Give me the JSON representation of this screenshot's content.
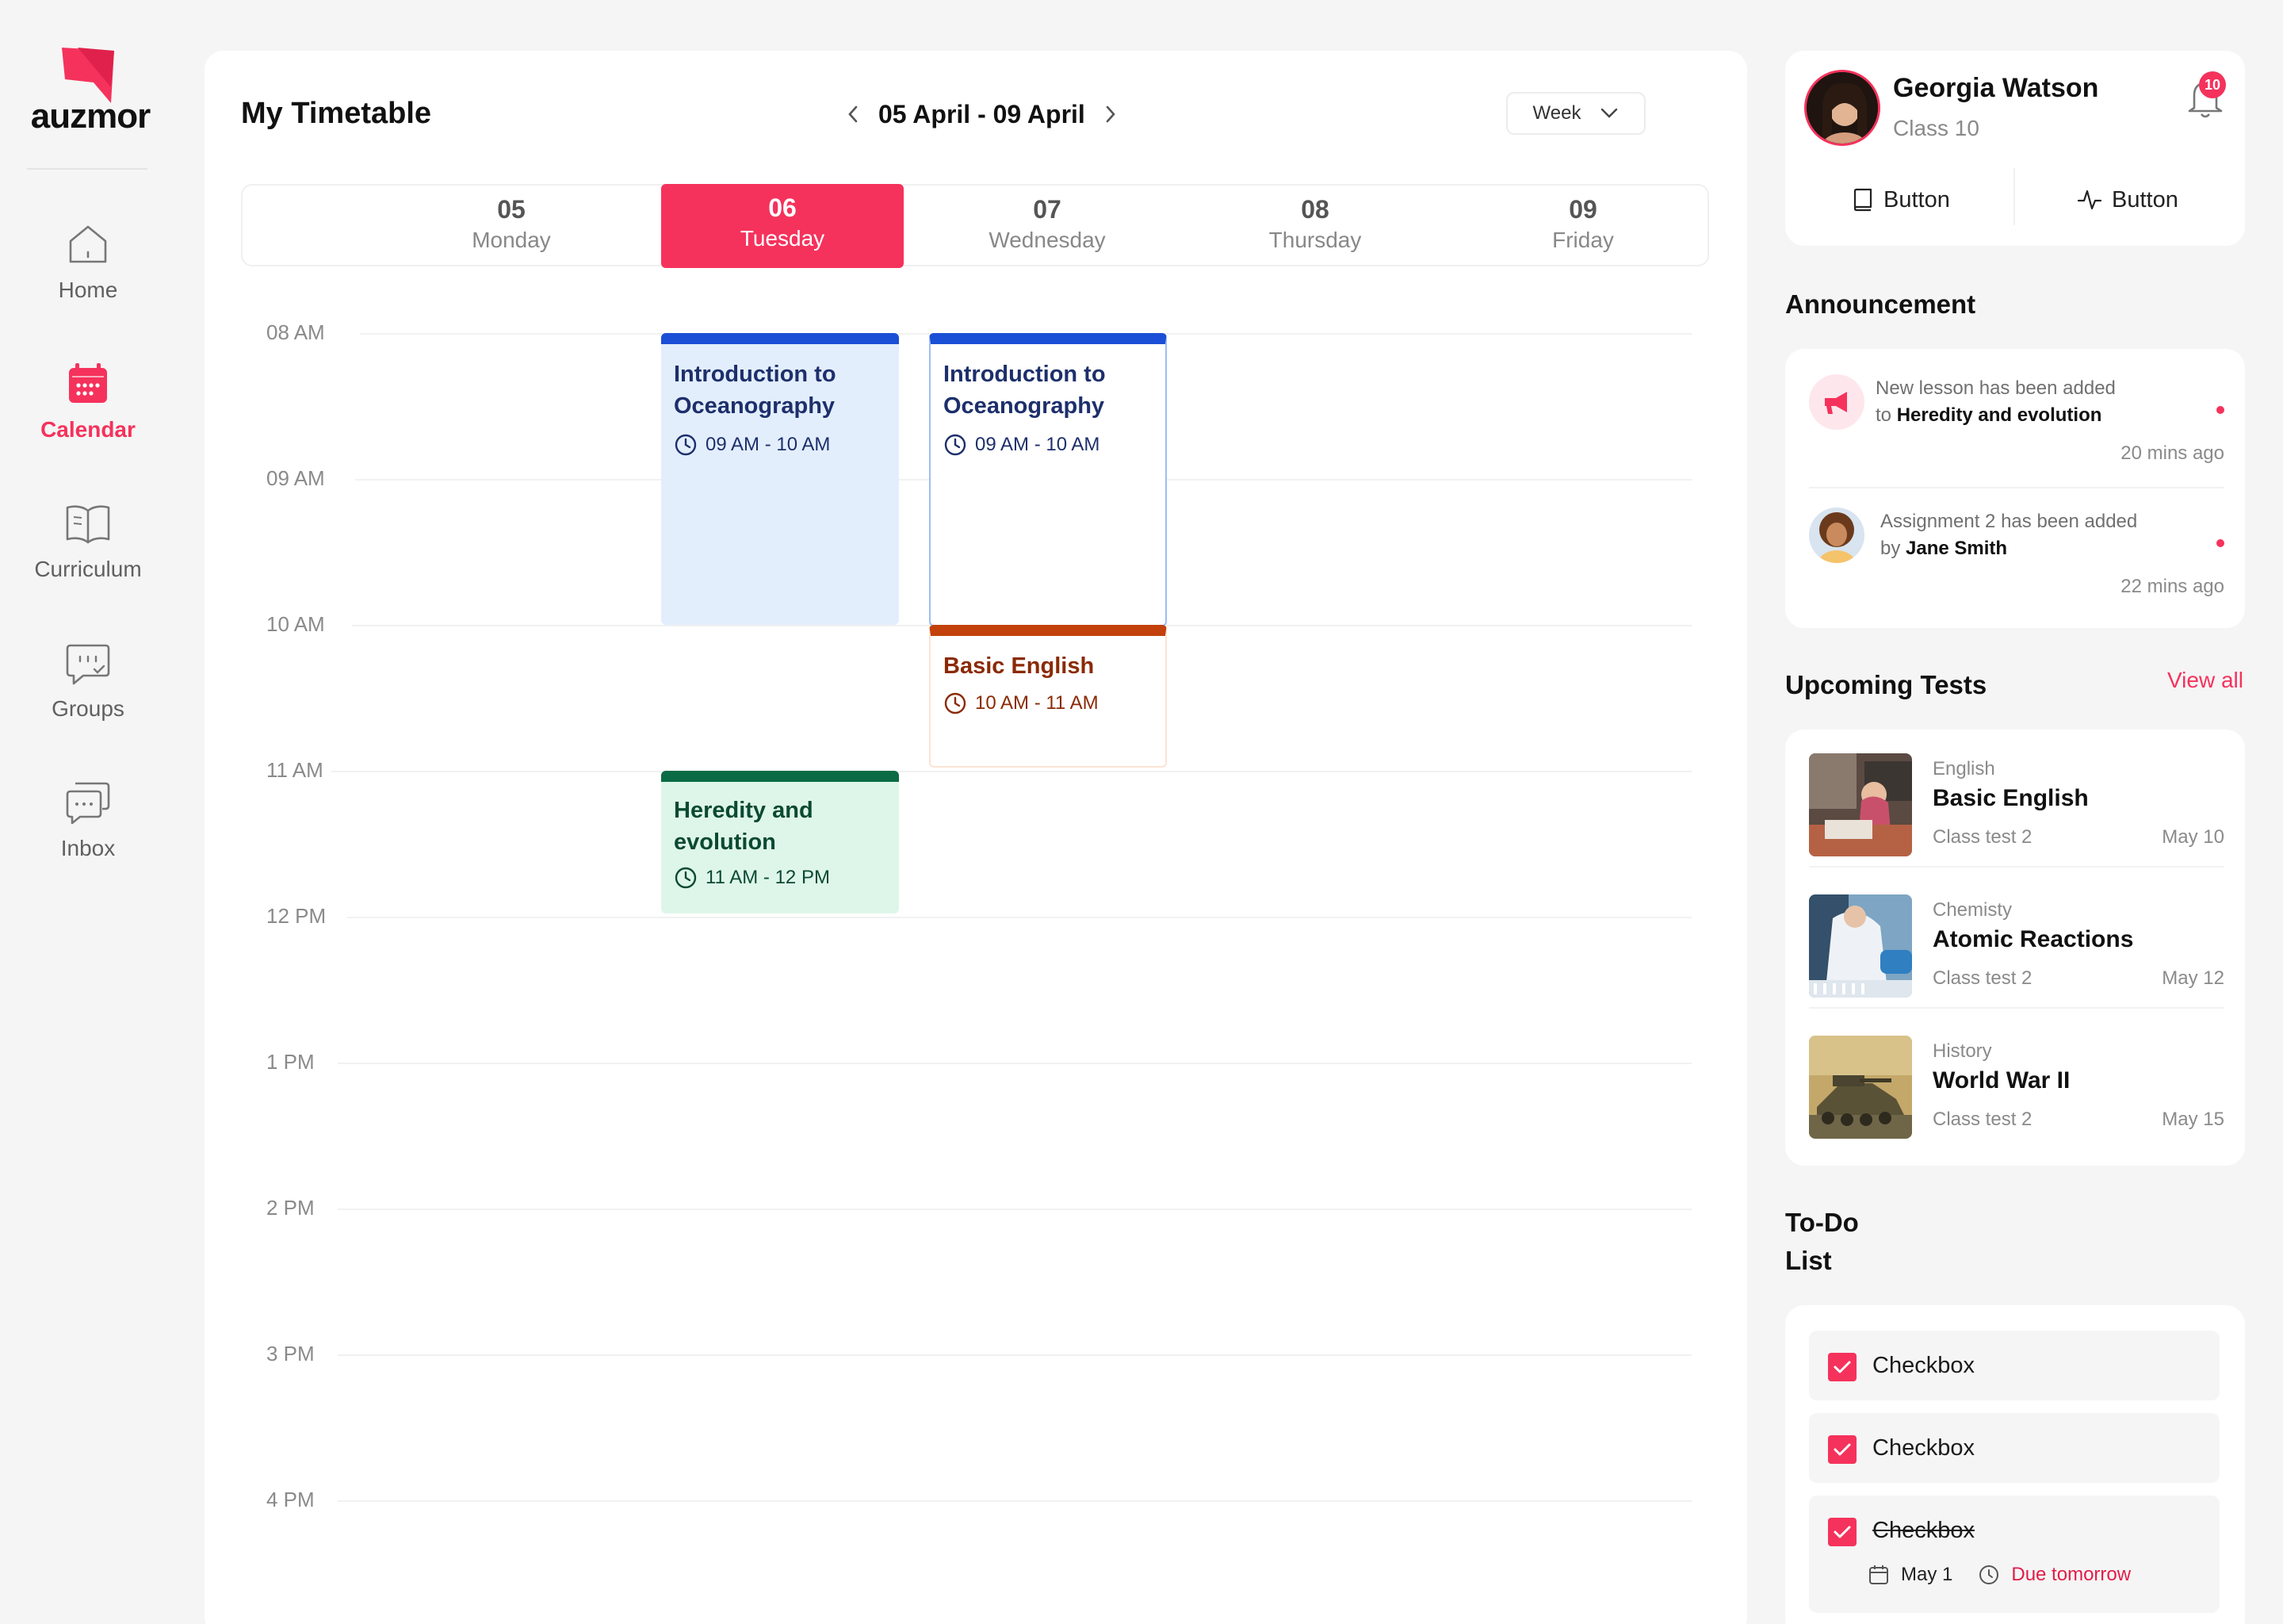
{
  "brand": {
    "name": "auzmor"
  },
  "nav": [
    {
      "label": "Home",
      "icon": "home-icon",
      "active": false
    },
    {
      "label": "Calendar",
      "icon": "calendar-icon",
      "active": true
    },
    {
      "label": "Curriculum",
      "icon": "book-icon",
      "active": false
    },
    {
      "label": "Groups",
      "icon": "groups-icon",
      "active": false
    },
    {
      "label": "Inbox",
      "icon": "inbox-icon",
      "active": false
    }
  ],
  "timetable": {
    "title": "My Timetable",
    "date_range": "05 April - 09 April",
    "view": "Week",
    "days": [
      {
        "num": "05",
        "name": "Monday",
        "active": false
      },
      {
        "num": "06",
        "name": "Tuesday",
        "active": true
      },
      {
        "num": "07",
        "name": "Wednesday",
        "active": false
      },
      {
        "num": "08",
        "name": "Thursday",
        "active": false
      },
      {
        "num": "09",
        "name": "Friday",
        "active": false
      }
    ],
    "times": [
      "08 AM",
      "09 AM",
      "10 AM",
      "11 AM",
      "12 PM",
      "1 PM",
      "2 PM",
      "3 PM",
      "4 PM"
    ],
    "events": [
      {
        "title": "Introduction to Oceanography",
        "time": "09 AM - 10 AM",
        "day": "Tuesday",
        "color": "#1b4fd6"
      },
      {
        "title": "Introduction to Oceanography",
        "time": "09 AM - 10 AM",
        "day": "Wednesday",
        "color": "#1b4fd6"
      },
      {
        "title": "Basic English",
        "time": "10 AM - 11 AM",
        "day": "Wednesday",
        "color": "#c2410c"
      },
      {
        "title": "Heredity and evolution",
        "time": "11 AM - 12 PM",
        "day": "Tuesday",
        "color": "#0b6b45"
      }
    ]
  },
  "profile": {
    "name": "Georgia Watson",
    "class": "Class 10",
    "notifications": "10",
    "button1": "Button",
    "button2": "Button"
  },
  "announcements": {
    "title": "Announcement",
    "items": [
      {
        "line1": "New lesson has been added",
        "prefix": "to",
        "bold": "Heredity and evolution",
        "time": "20 mins ago"
      },
      {
        "line1": "Assignment 2 has been added",
        "prefix": "by",
        "bold": "Jane Smith",
        "time": "22 mins ago"
      }
    ]
  },
  "tests": {
    "title": "Upcoming Tests",
    "view_all": "View all",
    "items": [
      {
        "subject": "English",
        "title": "Basic English",
        "meta": "Class test 2",
        "date": "May 10"
      },
      {
        "subject": "Chemisty",
        "title": "Atomic Reactions",
        "meta": "Class test 2",
        "date": "May 12"
      },
      {
        "subject": "History",
        "title": "World War II",
        "meta": "Class test 2",
        "date": "May 15"
      }
    ]
  },
  "todo": {
    "title_line1": "To-Do",
    "title_line2": "List",
    "items": [
      {
        "label": "Checkbox",
        "checked": true,
        "done": false
      },
      {
        "label": "Checkbox",
        "checked": true,
        "done": false
      },
      {
        "label": "Checkbox",
        "checked": true,
        "done": true,
        "date": "May 1",
        "due": "Due tomorrow"
      }
    ]
  },
  "colors": {
    "accent": "#f5325c",
    "background": "#f5f5f5",
    "card": "#ffffff"
  }
}
